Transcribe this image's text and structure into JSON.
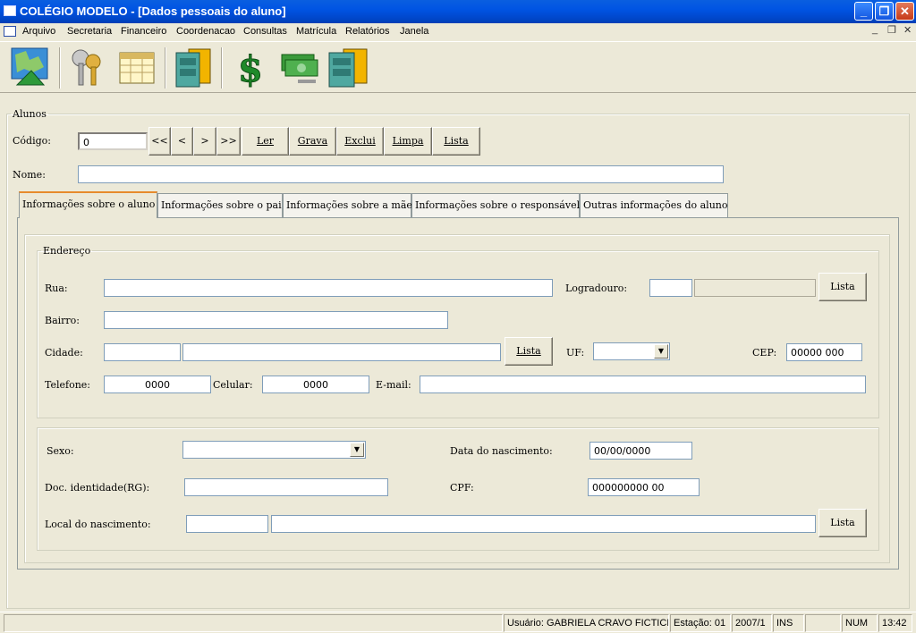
{
  "window": {
    "title": "COLÉGIO MODELO - [Dados pessoais do aluno]"
  },
  "menu": [
    "Arquivo",
    "Secretaria",
    "Financeiro",
    "Coordenacao",
    "Consultas",
    "Matrícula",
    "Relatórios",
    "Janela"
  ],
  "toolbar_icons": [
    "map-icon",
    "keys-icon",
    "calendar-icon",
    "file-cabinet-icon",
    "dollar-icon",
    "money-icon",
    "archive-icon"
  ],
  "alunos": {
    "group_label": "Alunos",
    "codigo_label": "Código:",
    "codigo_value": "0",
    "nav": [
      "<<",
      "<",
      ">",
      ">>"
    ],
    "actions": [
      "Ler",
      "Grava",
      "Exclui",
      "Limpa",
      "Lista"
    ],
    "nome_label": "Nome:",
    "nome_value": ""
  },
  "tabs": [
    "Informações sobre o aluno",
    "Informações sobre o pai",
    "Informações sobre a mãe",
    "Informações sobre o responsável",
    "Outras informações do aluno"
  ],
  "endereco": {
    "group_label": "Endereço",
    "rua_label": "Rua:",
    "logradouro_label": "Logradouro:",
    "lista_label": "Lista",
    "bairro_label": "Bairro:",
    "cidade_label": "Cidade:",
    "uf_label": "UF:",
    "cep_label": "CEP:",
    "cep_value": "00000 000",
    "telefone_label": "Telefone:",
    "telefone_value": "0000",
    "celular_label": "Celular:",
    "celular_value": "0000",
    "email_label": "E-mail:"
  },
  "pessoal": {
    "sexo_label": "Sexo:",
    "nascimento_label": "Data do nascimento:",
    "nascimento_value": "00/00/0000",
    "rg_label": "Doc. identidade(RG):",
    "cpf_label": "CPF:",
    "cpf_value": "000000000 00",
    "local_label": "Local do nascimento:",
    "lista_label": "Lista"
  },
  "status": {
    "usuario": "Usuário: GABRIELA CRAVO FICTICIO",
    "estacao": "Estação: 01",
    "periodo": "2007/1",
    "ins": "INS",
    "num": "NUM",
    "hora": "13:42"
  },
  "colors": {
    "titlebar": "#0054e3",
    "face": "#ece9d8",
    "tab_highlight": "#e68b2c"
  }
}
